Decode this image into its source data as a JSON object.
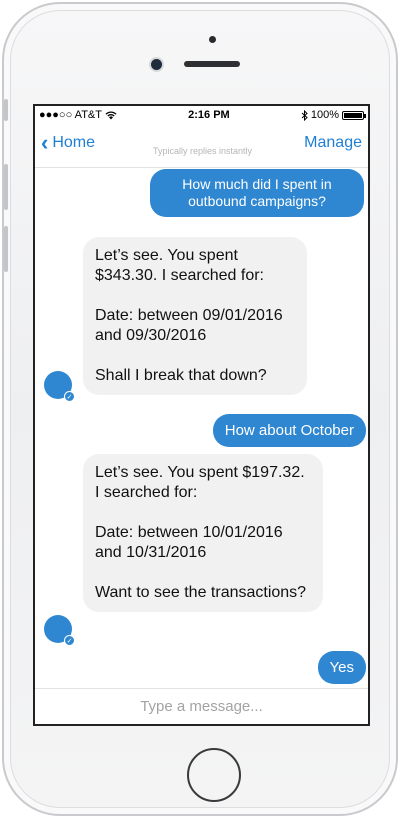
{
  "status": {
    "carrier": "●●●○○ AT&T",
    "wifi_icon": "wifi-icon",
    "time": "2:16 PM",
    "bluetooth_icon": "bluetooth-icon",
    "battery_label": "100%",
    "battery_level": 1.0
  },
  "nav": {
    "back_label": "Home",
    "subtitle": "Typically replies instantly",
    "manage_label": "Manage"
  },
  "messages": [
    {
      "from": "user",
      "text": "How much did I spent in outbound campaigns?"
    },
    {
      "from": "bot",
      "lines": [
        "Let’s see. You spent $343.30. I searched for:",
        "Date: between 09/01/2016 and 09/30/2016",
        "Shall I break that down?"
      ]
    },
    {
      "from": "user",
      "text": "How about October"
    },
    {
      "from": "bot",
      "lines": [
        "Let’s see. You spent $197.32. I searched for:",
        "Date: between 10/01/2016 and 10/31/2016",
        "Want to see the transactions?"
      ]
    },
    {
      "from": "user",
      "text": "Yes"
    }
  ],
  "composer": {
    "placeholder": "Type a message..."
  },
  "colors": {
    "accent": "#2f87d1",
    "link": "#1f7fd4",
    "bot_bubble": "#f1f1f2"
  }
}
